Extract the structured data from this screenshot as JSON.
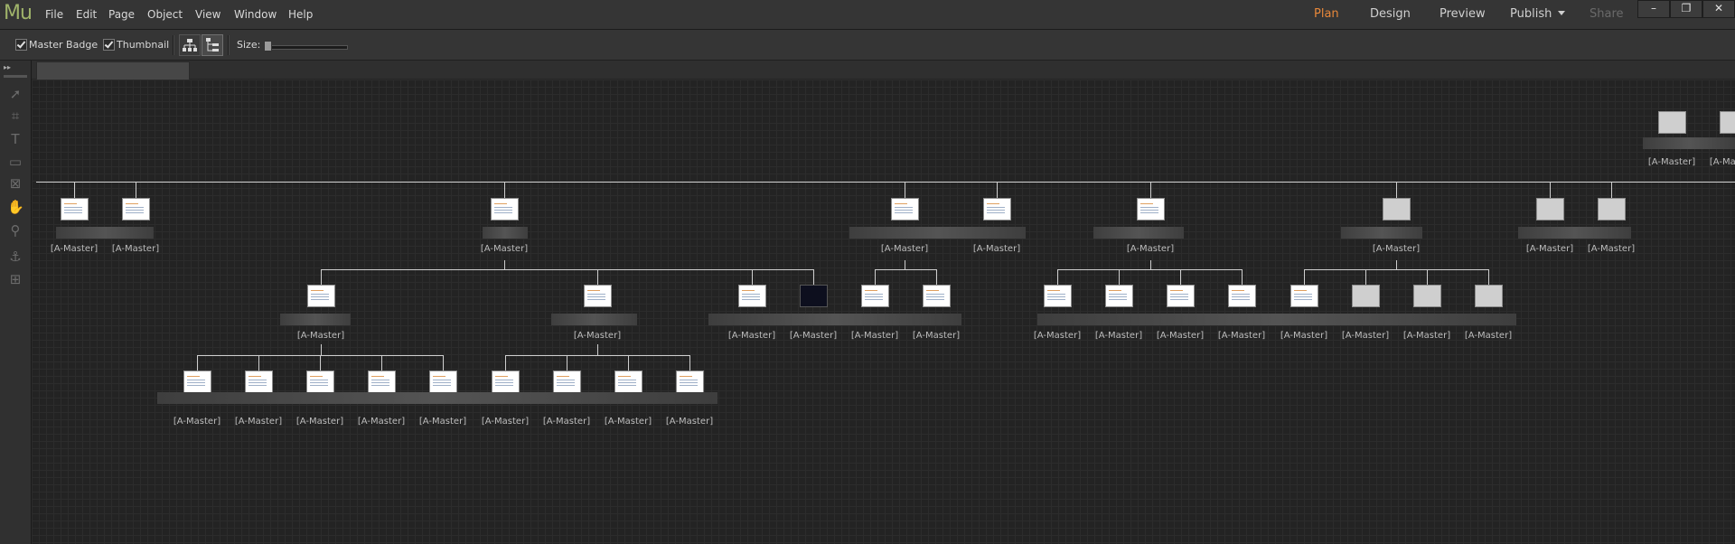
{
  "app": {
    "logo": "Mu"
  },
  "menu": [
    "File",
    "Edit",
    "Page",
    "Object",
    "View",
    "Window",
    "Help"
  ],
  "modes": {
    "plan": "Plan",
    "design": "Design",
    "preview": "Preview",
    "publish": "Publish",
    "share": "Share"
  },
  "window_controls": {
    "minimize": "–",
    "restore": "❐",
    "close": "✕"
  },
  "toolbar": {
    "master_badge": {
      "label": "Master Badge",
      "checked": true
    },
    "thumbnail": {
      "label": "Thumbnail",
      "checked": true
    },
    "size_label": "Size:"
  },
  "tools": [
    "selection-icon",
    "crop-icon",
    "text-icon",
    "rectangle-icon",
    "image-frame-icon",
    "hand-icon",
    "zoom-icon",
    "anchor-icon",
    "layout-guide-icon"
  ],
  "sitemap": {
    "master_label": "[A-Master]",
    "level1": [
      {
        "id": "p1"
      },
      {
        "id": "p2"
      },
      {
        "id": "p3"
      },
      {
        "id": "p4"
      },
      {
        "id": "p5"
      },
      {
        "id": "p6"
      },
      {
        "id": "p7",
        "blank": true
      },
      {
        "id": "p8",
        "blank": true
      },
      {
        "id": "p9",
        "blank": true
      }
    ],
    "level2": [
      {
        "id": "c1"
      },
      {
        "id": "c2"
      },
      {
        "id": "c3"
      },
      {
        "id": "c4",
        "dark": true
      },
      {
        "id": "c5"
      },
      {
        "id": "c6"
      },
      {
        "id": "c7"
      },
      {
        "id": "c8"
      },
      {
        "id": "c9"
      },
      {
        "id": "c10"
      },
      {
        "id": "c11"
      },
      {
        "id": "c12",
        "blank": true
      },
      {
        "id": "c13",
        "blank": true
      },
      {
        "id": "c14",
        "blank": true
      }
    ],
    "level3": [
      {
        "id": "g1"
      },
      {
        "id": "g2"
      },
      {
        "id": "g3"
      },
      {
        "id": "g4"
      },
      {
        "id": "g5"
      },
      {
        "id": "g6"
      },
      {
        "id": "g7"
      },
      {
        "id": "g8"
      },
      {
        "id": "g9"
      }
    ],
    "masters": [
      {
        "id": "m1",
        "blank": true
      },
      {
        "id": "m2",
        "blank": true
      }
    ]
  }
}
